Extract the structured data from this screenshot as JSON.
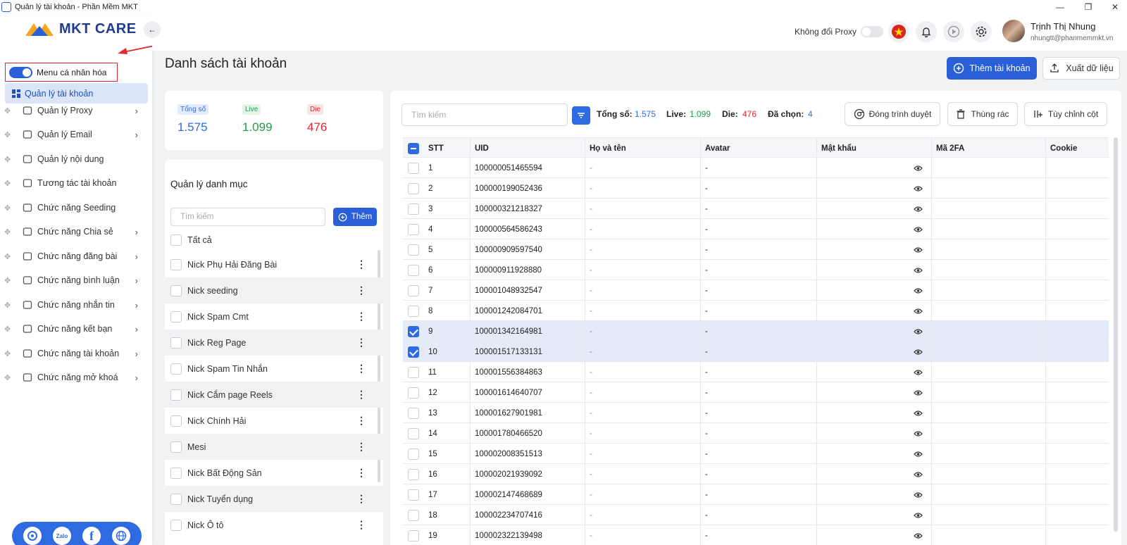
{
  "window": {
    "title": "Quản lý tài khoản - Phần Mềm MKT"
  },
  "sidebar": {
    "logo_text": "MKT CARE",
    "personal_menu_label": "Menu cá nhân hóa",
    "active_item": "Quản lý tài khoản",
    "items": [
      {
        "label": "Quản lý Proxy",
        "icon": "layers-icon",
        "has_arrow": true
      },
      {
        "label": "Quản lý Email",
        "icon": "mail-icon",
        "has_arrow": true
      },
      {
        "label": "Quản lý nội dung",
        "icon": "content-icon",
        "has_arrow": false
      },
      {
        "label": "Tương tác tài khoản",
        "icon": "interact-icon",
        "has_arrow": false
      },
      {
        "label": "Chức năng Seeding",
        "icon": "seeding-icon",
        "has_arrow": false
      },
      {
        "label": "Chức năng Chia sẻ",
        "icon": "share-icon",
        "has_arrow": true
      },
      {
        "label": "Chức năng đăng bài",
        "icon": "post-icon",
        "has_arrow": true
      },
      {
        "label": "Chức năng bình luận",
        "icon": "comment-icon",
        "has_arrow": true
      },
      {
        "label": "Chức năng nhắn tin",
        "icon": "message-icon",
        "has_arrow": true
      },
      {
        "label": "Chức năng kết bạn",
        "icon": "add-friend-icon",
        "has_arrow": true
      },
      {
        "label": "Chức năng tài khoản",
        "icon": "account-icon",
        "has_arrow": true
      },
      {
        "label": "Chức năng mở khoá",
        "icon": "unlock-icon",
        "has_arrow": true
      }
    ],
    "social": {
      "zalo": "Zalo",
      "facebook": "f"
    }
  },
  "header": {
    "proxy_label": "Không đổi Proxy",
    "user_name": "Trịnh Thị Nhung",
    "user_email": "nhungtt@phanmemmkt.vn"
  },
  "page": {
    "title": "Danh sách tài khoản",
    "add_button": "Thêm tài khoản",
    "export_button": "Xuất dữ liệu"
  },
  "stats": {
    "total_label": "Tổng số",
    "total_value": "1.575",
    "live_label": "Live",
    "live_value": "1.099",
    "die_label": "Die",
    "die_value": "476"
  },
  "categories": {
    "title": "Quản lý danh mục",
    "search_placeholder": "Tìm kiếm",
    "add_button": "Thêm",
    "all_label": "Tất cả",
    "items": [
      "Nick Phụ Hải Đăng Bài",
      "Nick seeding",
      "Nick Spam Cmt",
      "Nick Reg Page",
      "Nick Spam Tin Nhắn",
      "Nick Cắm page Reels",
      "Nick Chính Hải",
      "Mesi",
      "Nick Bất Động Sản",
      "Nick Tuyển dụng",
      "Nick Ô tô"
    ]
  },
  "table": {
    "search_placeholder": "Tìm kiếm",
    "summary": {
      "total_label": "Tổng số:",
      "total": "1.575",
      "live_label": "Live:",
      "live": "1.099",
      "die_label": "Die:",
      "die": "476",
      "selected_label": "Đã chọn:",
      "selected": "4"
    },
    "buttons": {
      "close_browser": "Đóng trình duyệt",
      "trash": "Thùng rác",
      "customize": "Tùy chỉnh cột"
    },
    "columns": [
      "STT",
      "UID",
      "Họ và tên",
      "Avatar",
      "Mật khẩu",
      "Mã 2FA",
      "Cookie"
    ],
    "rows": [
      {
        "stt": "1",
        "uid": "100000051465594",
        "name": "-",
        "avatar": "-",
        "selected": false
      },
      {
        "stt": "2",
        "uid": "100000199052436",
        "name": "-",
        "avatar": "-",
        "selected": false
      },
      {
        "stt": "3",
        "uid": "100000321218327",
        "name": "-",
        "avatar": "-",
        "selected": false
      },
      {
        "stt": "4",
        "uid": "100000564586243",
        "name": "-",
        "avatar": "-",
        "selected": false
      },
      {
        "stt": "5",
        "uid": "100000909597540",
        "name": "-",
        "avatar": "-",
        "selected": false
      },
      {
        "stt": "6",
        "uid": "100000911928880",
        "name": "-",
        "avatar": "-",
        "selected": false
      },
      {
        "stt": "7",
        "uid": "100001048932547",
        "name": "-",
        "avatar": "-",
        "selected": false
      },
      {
        "stt": "8",
        "uid": "100001242084701",
        "name": "-",
        "avatar": "-",
        "selected": false
      },
      {
        "stt": "9",
        "uid": "100001342164981",
        "name": "-",
        "avatar": "-",
        "selected": true
      },
      {
        "stt": "10",
        "uid": "100001517133131",
        "name": "-",
        "avatar": "-",
        "selected": true
      },
      {
        "stt": "11",
        "uid": "100001556384863",
        "name": "-",
        "avatar": "-",
        "selected": false
      },
      {
        "stt": "12",
        "uid": "100001614640707",
        "name": "-",
        "avatar": "-",
        "selected": false
      },
      {
        "stt": "13",
        "uid": "100001627901981",
        "name": "-",
        "avatar": "-",
        "selected": false
      },
      {
        "stt": "14",
        "uid": "100001780466520",
        "name": "-",
        "avatar": "-",
        "selected": false
      },
      {
        "stt": "15",
        "uid": "100002008351513",
        "name": "-",
        "avatar": "-",
        "selected": false
      },
      {
        "stt": "16",
        "uid": "100002021939092",
        "name": "-",
        "avatar": "-",
        "selected": false
      },
      {
        "stt": "17",
        "uid": "100002147468689",
        "name": "-",
        "avatar": "-",
        "selected": false
      },
      {
        "stt": "18",
        "uid": "100002234707416",
        "name": "-",
        "avatar": "-",
        "selected": false
      },
      {
        "stt": "19",
        "uid": "100002322139498",
        "name": "-",
        "avatar": "-",
        "selected": false
      }
    ]
  },
  "colors": {
    "primary": "#2b5fd8",
    "live": "#1f9d4a",
    "die": "#e0282e",
    "highlight": "#e0282e"
  }
}
